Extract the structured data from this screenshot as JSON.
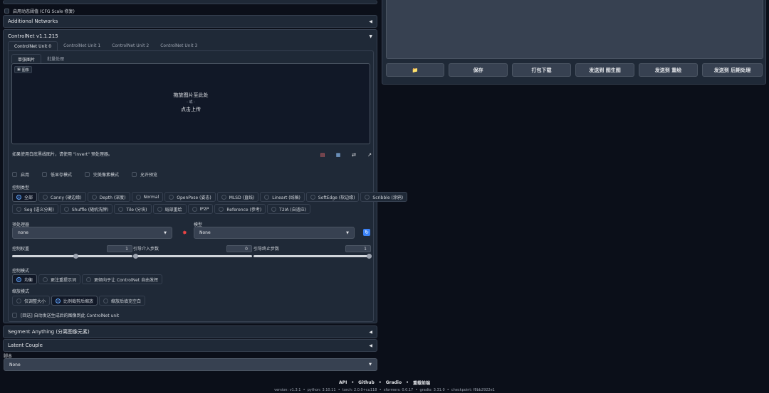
{
  "top": {
    "cfg_checkbox_label": "启用动态阈值 (CFG Scale 修复)"
  },
  "additional_networks": {
    "title": "Additional Networks"
  },
  "controlnet": {
    "title": "ControlNet v1.1.215",
    "unit_tabs": [
      "ControlNet Unit 0",
      "ControlNet Unit 1",
      "ControlNet Unit 2",
      "ControlNet Unit 3"
    ],
    "image_tabs": [
      "单张图片",
      "批量处理"
    ],
    "image_label": "图像",
    "drop_line1": "拖放图片至此处",
    "drop_line2": "- 或 -",
    "drop_line3": "点击上传",
    "invert_hint": "如果使用白底黑线图片，请使用 \"invert\" 预处理器。",
    "checkboxes": [
      "启用",
      "低显存模式",
      "完美像素模式",
      "允许预览"
    ],
    "control_type_label": "控制类型",
    "control_types_row1": [
      "全部",
      "Canny (硬边缘)",
      "Depth (深度)",
      "Normal",
      "OpenPose (姿态)",
      "MLSD (直线)",
      "Lineart (线稿)",
      "SoftEdge (软边缘)",
      "Scribble (涂鸦)"
    ],
    "control_types_row2": [
      "Seg (语义分割)",
      "Shuffle (随机洗牌)",
      "Tile (分块)",
      "局部重绘",
      "IP2P",
      "Reference (参考)",
      "T2IA (自适应)"
    ],
    "preprocessor_label": "预处理器",
    "preprocessor_value": "none",
    "model_label": "模型",
    "model_value": "None",
    "weight_label": "控制权重",
    "weight_value": "1",
    "start_label": "引导介入步数",
    "start_value": "0",
    "end_label": "引导终止步数",
    "end_value": "1",
    "control_mode_label": "控制模式",
    "control_modes": [
      "均衡",
      "更注重提示词",
      "更倾向于让 ControlNet 自由发挥"
    ],
    "resize_mode_label": "缩放模式",
    "resize_modes": [
      "仅调整大小",
      "比例裁剪后缩放",
      "缩放后填充空白"
    ],
    "loopback_label": "[回送] 自动发送生成后的图像到此 ControlNet unit"
  },
  "segment_anything": {
    "title": "Segment Anything (分离图像元素)"
  },
  "latent_couple": {
    "title": "Latent Couple"
  },
  "script": {
    "label": "脚本",
    "value": "None"
  },
  "right_buttons": {
    "folder_icon": "📁",
    "save": "保存",
    "zip": "打包下载",
    "send_img2img": "发送到 图生图",
    "send_inpaint": "发送到 重绘",
    "send_extras": "发送到 后期处理"
  },
  "footer": {
    "links": [
      "API",
      "Github",
      "Gradio",
      "重载前端"
    ],
    "version": "version: v1.3.1  •  python: 3.10.11  •  torch: 2.0.0+cu118  •  xformers: 0.0.17  •  gradio: 3.31.0  •  checkpoint: f8bb2922e1"
  },
  "colors": {
    "accent": "#2563eb",
    "background": "#0b0f19",
    "panel": "#1f2937"
  }
}
